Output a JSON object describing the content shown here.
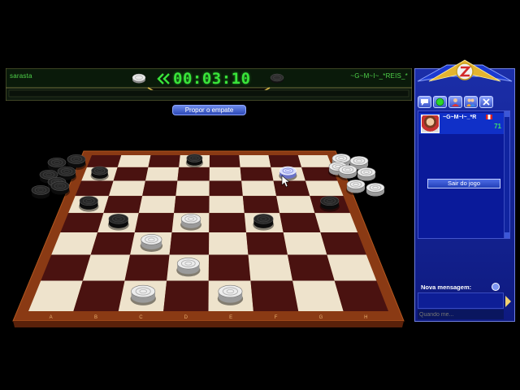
{
  "scoreboard": {
    "left_player": "sarasta",
    "right_player": "~G~M~I~_*REIS_*",
    "timer": "00:03:10",
    "left_player_color": "white",
    "right_player_color": "black"
  },
  "draw_button": "Propor o empate",
  "board": {
    "files": [
      "A",
      "B",
      "C",
      "D",
      "E",
      "F",
      "G",
      "H"
    ],
    "light_square": "#eee3cc",
    "dark_square": "#4a1210",
    "frame_color": "#8a3a14",
    "pieces": [
      {
        "color": "black",
        "file": 4,
        "rank": 8
      },
      {
        "color": "black",
        "file": 1,
        "rank": 7
      },
      {
        "color": "selected-white",
        "file": 7,
        "rank": 7
      },
      {
        "color": "black",
        "file": 1,
        "rank": 5
      },
      {
        "color": "black",
        "file": 8,
        "rank": 5
      },
      {
        "color": "black",
        "file": 2,
        "rank": 4
      },
      {
        "color": "white",
        "file": 4,
        "rank": 4
      },
      {
        "color": "black",
        "file": 6,
        "rank": 4
      },
      {
        "color": "white",
        "file": 3,
        "rank": 3
      },
      {
        "color": "white",
        "file": 4,
        "rank": 2
      },
      {
        "color": "white",
        "file": 3,
        "rank": 1
      },
      {
        "color": "white",
        "file": 5,
        "rank": 1
      }
    ],
    "captured_black_count": 7,
    "captured_white_count": 7
  },
  "panel": {
    "tabs": [
      "chat-icon",
      "status-icon",
      "user-icon",
      "friends-icon",
      "settings-icon"
    ],
    "user": {
      "name": "~G~M~I~_*R",
      "score": "71"
    },
    "leave_button": "Sair do jogo",
    "new_message_label": "Nova mensagem:",
    "message_placeholder": "Quando me..."
  }
}
